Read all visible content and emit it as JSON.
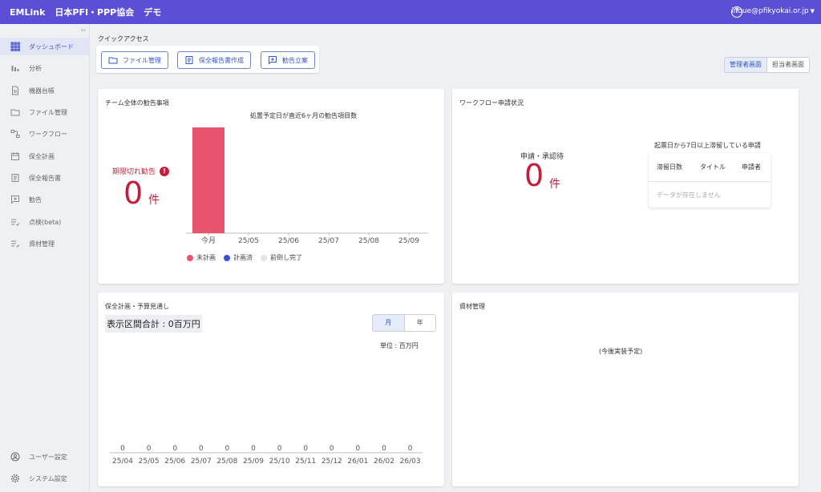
{
  "header": {
    "brand": "EMLink",
    "org": "日本PFI・PPP協会",
    "demo": "デモ",
    "user_email": "inoue@pfikyokai.or.jp"
  },
  "sidebar": {
    "items": [
      {
        "label": "ダッシュボード",
        "icon": "grid-icon",
        "active": true
      },
      {
        "label": "分析",
        "icon": "bar-chart-icon"
      },
      {
        "label": "機器台帳",
        "icon": "document-icon"
      },
      {
        "label": "ファイル管理",
        "icon": "folder-icon"
      },
      {
        "label": "ワークフロー",
        "icon": "workflow-icon"
      },
      {
        "label": "保全計画",
        "icon": "calendar-icon"
      },
      {
        "label": "保全報告書",
        "icon": "report-icon"
      },
      {
        "label": "勧告",
        "icon": "add-comment-icon"
      },
      {
        "label": "点検(beta)",
        "icon": "checklist-icon"
      },
      {
        "label": "資材管理",
        "icon": "checklist-icon"
      }
    ],
    "bottom_items": [
      {
        "label": "ユーザー設定",
        "icon": "user-icon"
      },
      {
        "label": "システム設定",
        "icon": "gear-icon"
      }
    ]
  },
  "quick_access": {
    "title": "クイックアクセス",
    "buttons": [
      {
        "label": "ファイル管理",
        "icon": "folder-icon"
      },
      {
        "label": "保全報告書作成",
        "icon": "report-icon"
      },
      {
        "label": "勧告立案",
        "icon": "add-comment-icon"
      }
    ]
  },
  "view_toggle": {
    "admin": "管理者画面",
    "staff": "担当者画面"
  },
  "recommendations_card": {
    "title": "チーム全体の勧告事項",
    "overdue_label": "期限切れ勧告",
    "overdue_count": "0",
    "unit": "件",
    "legend": [
      {
        "name": "未計画",
        "color": "#e8546e"
      },
      {
        "name": "計画済",
        "color": "#3b4fd8"
      },
      {
        "name": "前倒し完了",
        "color": "#e4e4e4"
      }
    ]
  },
  "workflow_card": {
    "title": "ワークフロー申請状況",
    "pending_label": "申請・承認待",
    "pending_count": "0",
    "unit": "件",
    "stale_title": "起票日から7日以上滞留している申請",
    "columns": [
      "滞留日数",
      "タイトル",
      "申請者"
    ],
    "empty_text": "データが存在しません"
  },
  "budget_card": {
    "title": "保全計画・予算見通し",
    "total": "表示区間合計 : 0百万円",
    "period_month": "月",
    "period_year": "年",
    "unit_label": "単位 : 百万円"
  },
  "materials_card": {
    "title": "資材管理",
    "placeholder": "(今後実装予定)"
  },
  "chart_data": [
    {
      "type": "bar",
      "title": "処置予定日が直近6ヶ月の勧告項目数",
      "categories": [
        "今月",
        "25/05",
        "25/06",
        "25/07",
        "25/08",
        "25/09"
      ],
      "series": [
        {
          "name": "未計画",
          "values": [
            1,
            0,
            0,
            0,
            0,
            0
          ]
        },
        {
          "name": "計画済",
          "values": [
            0,
            0,
            0,
            0,
            0,
            0
          ]
        },
        {
          "name": "前倒し完了",
          "values": [
            0,
            0,
            0,
            0,
            0,
            0
          ]
        }
      ],
      "ylim": [
        0,
        1
      ],
      "grid": false,
      "legend": "bottom"
    },
    {
      "type": "bar",
      "title": "",
      "categories": [
        "25/04",
        "25/05",
        "25/06",
        "25/07",
        "25/08",
        "25/09",
        "25/10",
        "25/11",
        "25/12",
        "26/01",
        "26/02",
        "26/03"
      ],
      "values": [
        0,
        0,
        0,
        0,
        0,
        0,
        0,
        0,
        0,
        0,
        0,
        0
      ],
      "data_labels": [
        "0",
        "0",
        "0",
        "0",
        "0",
        "0",
        "0",
        "0",
        "0",
        "0",
        "0",
        "0"
      ],
      "grid": false
    }
  ]
}
